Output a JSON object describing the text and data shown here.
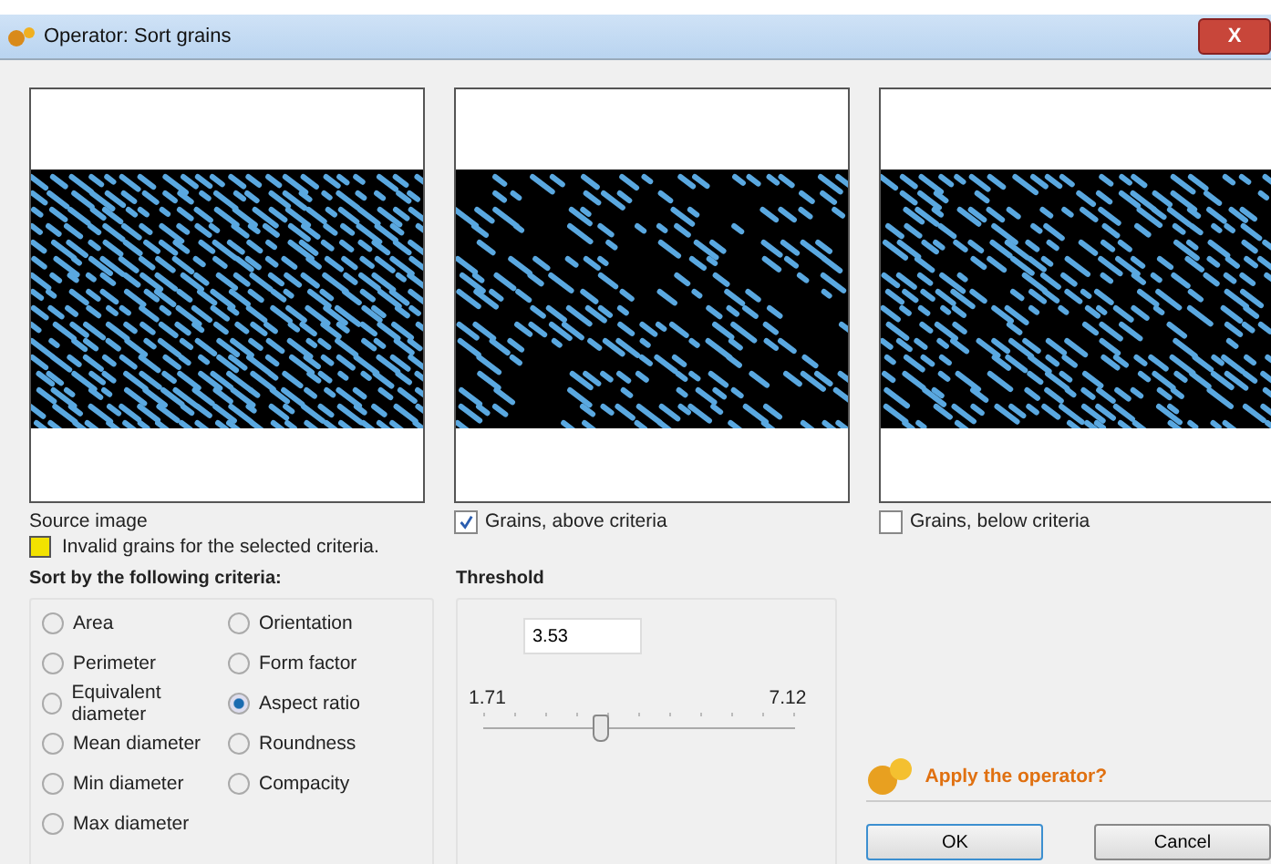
{
  "window": {
    "title": "Operator: Sort grains",
    "close": "X"
  },
  "panels": [
    {
      "caption": "Source image",
      "kind": "label"
    },
    {
      "caption": "Grains, above criteria",
      "kind": "checkbox",
      "checked": true
    },
    {
      "caption": "Grains, below criteria",
      "kind": "checkbox",
      "checked": false
    }
  ],
  "legend": {
    "text": "Invalid grains for the selected criteria."
  },
  "criteria": {
    "title": "Sort by the following criteria:",
    "options": [
      {
        "label": "Area",
        "selected": false
      },
      {
        "label": "Orientation",
        "selected": false
      },
      {
        "label": "Perimeter",
        "selected": false
      },
      {
        "label": "Form factor",
        "selected": false
      },
      {
        "label": "Equivalent diameter",
        "selected": false
      },
      {
        "label": "Aspect ratio",
        "selected": true
      },
      {
        "label": "Mean diameter",
        "selected": false
      },
      {
        "label": "Roundness",
        "selected": false
      },
      {
        "label": "Min diameter",
        "selected": false
      },
      {
        "label": "Compacity",
        "selected": false
      },
      {
        "label": "Max diameter",
        "selected": false
      }
    ]
  },
  "threshold": {
    "title": "Threshold",
    "value": "3.53",
    "min": "1.71",
    "max": "7.12",
    "level": 0.37
  },
  "apply": {
    "question": "Apply the operator?",
    "buttons": [
      "OK",
      "Cancel"
    ]
  }
}
